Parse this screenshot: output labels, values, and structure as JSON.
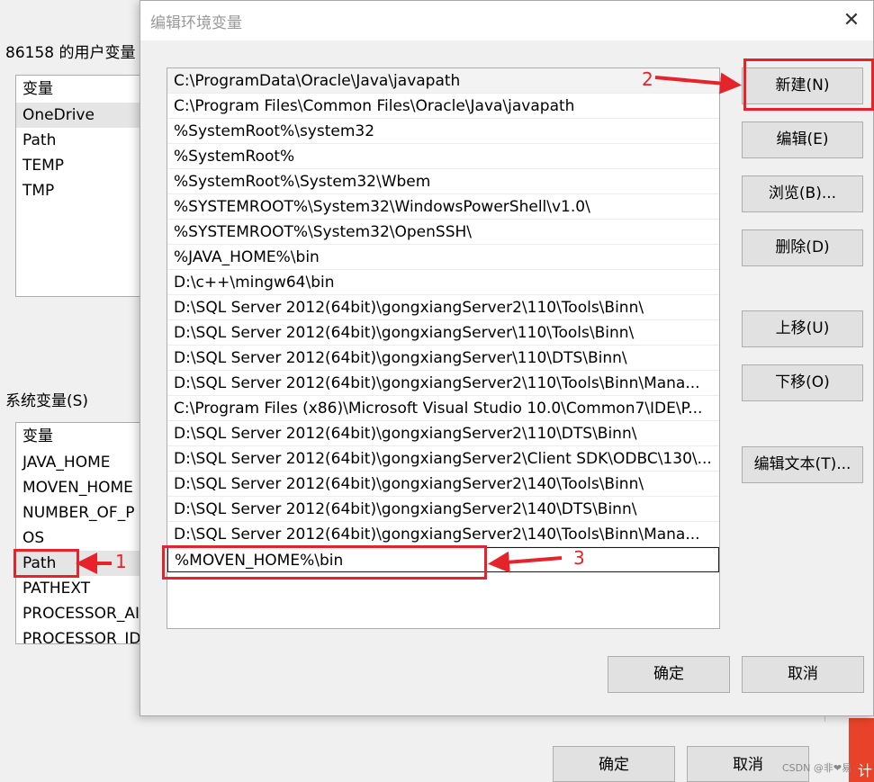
{
  "background_dialog": {
    "user_vars_label": "86158 的用户变量",
    "user_vars": {
      "header": "变量",
      "items": [
        "OneDrive",
        "Path",
        "TEMP",
        "TMP"
      ]
    },
    "system_vars_label": "系统变量(S)",
    "system_vars": {
      "header": "变量",
      "items": [
        "JAVA_HOME",
        "MOVEN_HOME",
        "NUMBER_OF_P",
        "OS",
        "Path",
        "PATHEXT",
        "PROCESSOR_AI",
        "PROCESSOR_ID"
      ]
    },
    "ok_label": "确定",
    "cancel_label": "取消",
    "red_strip_text": "计"
  },
  "edit_dialog": {
    "title": "编辑环境变量",
    "close_glyph": "✕",
    "path_entries": [
      "C:\\ProgramData\\Oracle\\Java\\javapath",
      "C:\\Program Files\\Common Files\\Oracle\\Java\\javapath",
      "%SystemRoot%\\system32",
      "%SystemRoot%",
      "%SystemRoot%\\System32\\Wbem",
      "%SYSTEMROOT%\\System32\\WindowsPowerShell\\v1.0\\",
      "%SYSTEMROOT%\\System32\\OpenSSH\\",
      "%JAVA_HOME%\\bin",
      "D:\\c++\\mingw64\\bin",
      "D:\\SQL Server 2012(64bit)\\gongxiangServer2\\110\\Tools\\Binn\\",
      "D:\\SQL Server 2012(64bit)\\gongxiangServer\\110\\Tools\\Binn\\",
      "D:\\SQL Server 2012(64bit)\\gongxiangServer\\110\\DTS\\Binn\\",
      "D:\\SQL Server 2012(64bit)\\gongxiangServer2\\110\\Tools\\Binn\\Mana...",
      "C:\\Program Files (x86)\\Microsoft Visual Studio 10.0\\Common7\\IDE\\P...",
      "D:\\SQL Server 2012(64bit)\\gongxiangServer2\\110\\DTS\\Binn\\",
      "D:\\SQL Server 2012(64bit)\\gongxiangServer2\\Client SDK\\ODBC\\130\\...",
      "D:\\SQL Server 2012(64bit)\\gongxiangServer2\\140\\Tools\\Binn\\",
      "D:\\SQL Server 2012(64bit)\\gongxiangServer2\\140\\DTS\\Binn\\",
      "D:\\SQL Server 2012(64bit)\\gongxiangServer2\\140\\Tools\\Binn\\Mana..."
    ],
    "new_entry_value": "%MOVEN_HOME%\\bin",
    "buttons": {
      "new": "新建(N)",
      "edit": "编辑(E)",
      "browse": "浏览(B)...",
      "delete": "删除(D)",
      "move_up": "上移(U)",
      "move_down": "下移(O)",
      "edit_text": "编辑文本(T)...",
      "ok": "确定",
      "cancel": "取消"
    }
  },
  "annotations": {
    "step1": "1",
    "step2": "2",
    "step3": "3",
    "color": "#e4242a"
  },
  "watermark": "CSDN @非❤易"
}
